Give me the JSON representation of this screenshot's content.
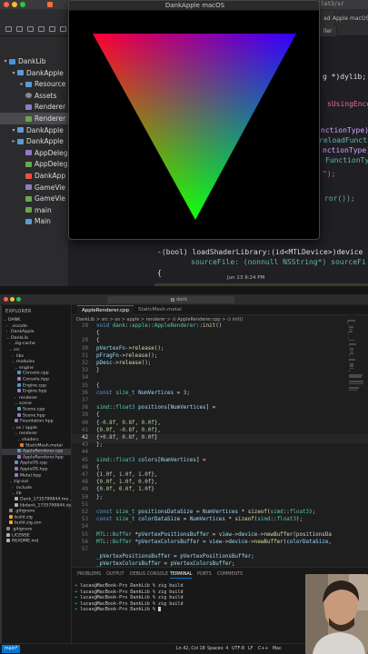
{
  "xcode": {
    "window_title": "DankApple macOS",
    "title_fragment": "ullet3/sr",
    "tabs": [
      "ad",
      "ller",
      "Apple macOS"
    ],
    "status_fragment": "Jun 13 9:24 PM",
    "navigator": [
      {
        "label": "DankLib",
        "depth": 0,
        "open": true,
        "icon": "package-icon"
      },
      {
        "label": "DankApple",
        "depth": 1,
        "open": true,
        "icon": "folder-icon"
      },
      {
        "label": "Resource",
        "depth": 2,
        "open": false,
        "icon": "folder-icon"
      },
      {
        "label": "Assets",
        "depth": 2,
        "open": null,
        "icon": "assets-icon"
      },
      {
        "label": "Renderer",
        "depth": 2,
        "open": null,
        "icon": "header-icon"
      },
      {
        "label": "Renderer",
        "depth": 2,
        "open": null,
        "icon": "objc-icon",
        "selected": true
      },
      {
        "label": "DankApple",
        "depth": 1,
        "open": true,
        "icon": "folder-icon"
      },
      {
        "label": "DankApple",
        "depth": 1,
        "open": false,
        "icon": "folder-icon"
      },
      {
        "label": "AppDeleg",
        "depth": 2,
        "open": null,
        "icon": "header-icon"
      },
      {
        "label": "AppDeleg",
        "depth": 2,
        "open": null,
        "icon": "objc-icon"
      },
      {
        "label": "DankApp",
        "depth": 2,
        "open": null,
        "icon": "swift-icon"
      },
      {
        "label": "GameVie",
        "depth": 2,
        "open": null,
        "icon": "header-icon"
      },
      {
        "label": "GameVie",
        "depth": 2,
        "open": null,
        "icon": "objc-icon"
      },
      {
        "label": "main",
        "depth": 2,
        "open": null,
        "icon": "objc-icon"
      },
      {
        "label": "Main",
        "depth": 2,
        "open": null,
        "icon": "storyboard-icon"
      }
    ],
    "code_fragments": [
      "g *)dylib; -",
      "sUsingEncoding",
      "nctionType)d",
      "reloadFunctio",
      "nctionType)dls",
      "FunctionType)",
      "\");",
      "ror());",
      "-(bool) loadShaderLibrary:(id<MTLDevice>)device",
      "sourceFile: (nonnull NSString*) sourceFi",
      "{"
    ]
  },
  "vscode": {
    "search_text": "dank",
    "explorer_title": "EXPLORER",
    "tree": [
      {
        "label": "DANK",
        "depth": 0,
        "kind": "root"
      },
      {
        "label": ".vscode",
        "depth": 1,
        "kind": "folder",
        "collapsed": true
      },
      {
        "label": "DankApple",
        "depth": 1,
        "kind": "folder",
        "collapsed": true
      },
      {
        "label": "DankLib",
        "depth": 1,
        "kind": "folder"
      },
      {
        "label": ".zig-cache",
        "depth": 2,
        "kind": "folder",
        "collapsed": true
      },
      {
        "label": "src",
        "depth": 2,
        "kind": "folder"
      },
      {
        "label": "libs",
        "depth": 3,
        "kind": "folder",
        "collapsed": true
      },
      {
        "label": "modules",
        "depth": 3,
        "kind": "folder"
      },
      {
        "label": "engine",
        "depth": 4,
        "kind": "folder"
      },
      {
        "label": "Console.cpp",
        "depth": 5,
        "kind": "cpp"
      },
      {
        "label": "Console.hpp",
        "depth": 5,
        "kind": "hpp"
      },
      {
        "label": "Engine.cpp",
        "depth": 5,
        "kind": "cpp"
      },
      {
        "label": "Engine.hpp",
        "depth": 5,
        "kind": "hpp"
      },
      {
        "label": "renderer",
        "depth": 4,
        "kind": "folder",
        "collapsed": true
      },
      {
        "label": "scene",
        "depth": 4,
        "kind": "folder"
      },
      {
        "label": "Scene.cpp",
        "depth": 5,
        "kind": "cpp"
      },
      {
        "label": "Scene.hpp",
        "depth": 5,
        "kind": "hpp"
      },
      {
        "label": "Foundation.hpp",
        "depth": 4,
        "kind": "hpp"
      },
      {
        "label": "os / apple",
        "depth": 3,
        "kind": "folder"
      },
      {
        "label": "renderer",
        "depth": 4,
        "kind": "folder"
      },
      {
        "label": "shaders",
        "depth": 5,
        "kind": "folder"
      },
      {
        "label": "StaticMesh.metal",
        "depth": 6,
        "kind": "metal"
      },
      {
        "label": "AppleRenderer.cpp",
        "depth": 5,
        "kind": "cpp",
        "selected": true
      },
      {
        "label": "AppleRenderer.hpp",
        "depth": 5,
        "kind": "hpp"
      },
      {
        "label": "AppleOS.cpp",
        "depth": 4,
        "kind": "cpp"
      },
      {
        "label": "AppleOS.hpp",
        "depth": 4,
        "kind": "hpp"
      },
      {
        "label": "Metal.hpp",
        "depth": 4,
        "kind": "hpp"
      },
      {
        "label": "zig-out",
        "depth": 2,
        "kind": "folder"
      },
      {
        "label": "include",
        "depth": 3,
        "kind": "folder",
        "collapsed": true
      },
      {
        "label": "lib",
        "depth": 3,
        "kind": "folder"
      },
      {
        "label": "Dank_1735799844.mo...",
        "depth": 4,
        "kind": "file"
      },
      {
        "label": "libdank_1735799844.dy...",
        "depth": 4,
        "kind": "file"
      },
      {
        "label": ".gitignore",
        "depth": 2,
        "kind": "git"
      },
      {
        "label": "build.zig",
        "depth": 2,
        "kind": "zig"
      },
      {
        "label": "build.zig.zon",
        "depth": 2,
        "kind": "zig"
      },
      {
        "label": ".gitignore",
        "depth": 1,
        "kind": "git"
      },
      {
        "label": "LICENSE",
        "depth": 1,
        "kind": "info"
      },
      {
        "label": "README.md",
        "depth": 1,
        "kind": "info"
      }
    ],
    "tabs": [
      {
        "label": "AppleRenderer.cpp",
        "active": true
      },
      {
        "label": "StaticMesh.metal",
        "active": false
      }
    ],
    "breadcrumb": "DankLib > src > os > apple > renderer > ⊙ AppleRenderer.cpp > ⊙ init()",
    "current_line": 42,
    "code": [
      {
        "n": "28",
        "t": "void dank::apple::AppleRenderer::init()"
      },
      {
        "n": "",
        "t": "{"
      },
      {
        "n": "29",
        "t": "    {"
      },
      {
        "n": "30",
        "t": "        pVertexFn->release();"
      },
      {
        "n": "31",
        "t": "        pFragFn->release();"
      },
      {
        "n": "32",
        "t": "        pDesc->release();"
      },
      {
        "n": "33",
        "t": "    }"
      },
      {
        "n": "34",
        "t": ""
      },
      {
        "n": "35",
        "t": "    {"
      },
      {
        "n": "36",
        "t": "        const size_t NumVertices = 3;"
      },
      {
        "n": "37",
        "t": ""
      },
      {
        "n": "38",
        "t": "        simd::float3 positions[NumVertices] ="
      },
      {
        "n": "39",
        "t": "        {"
      },
      {
        "n": "40",
        "t": "            {-0.8f, 0.8f, 0.0f},"
      },
      {
        "n": "41",
        "t": "            {0.0f, -0.8f, 0.0f},"
      },
      {
        "n": "42",
        "t": "            {+0.8f, 0.8f, 0.0f}"
      },
      {
        "n": "43",
        "t": "        };"
      },
      {
        "n": "44",
        "t": ""
      },
      {
        "n": "45",
        "t": "        simd::float3 colors[NumVertices] ="
      },
      {
        "n": "46",
        "t": "        {"
      },
      {
        "n": "47",
        "t": "            {1.0f, 1.0f, 1.0f},"
      },
      {
        "n": "48",
        "t": "            {0.0f, 1.0f, 0.0f},"
      },
      {
        "n": "49",
        "t": "            {0.0f, 0.0f, 1.0f}"
      },
      {
        "n": "50",
        "t": "        };"
      },
      {
        "n": "51",
        "t": ""
      },
      {
        "n": "52",
        "t": "        const size_t positionsDataSize = NumVertices * sizeof(simd::float3);"
      },
      {
        "n": "53",
        "t": "        const size_t colorDataSize = NumVertices * sizeof(simd::float3);"
      },
      {
        "n": "54",
        "t": ""
      },
      {
        "n": "55",
        "t": "        MTL::Buffer *pVertexPositionsBuffer = view->device->newBuffer(positionsDa"
      },
      {
        "n": "56",
        "t": "        MTL::Buffer *pVertexColorsBuffer = view->device->newBuffer(colorDataSize,"
      },
      {
        "n": "57",
        "t": ""
      },
      {
        "n": "",
        "t": "        _pVertexPositionsBuffer = pVertexPositionsBuffer;"
      },
      {
        "n": "",
        "t": "        _pVertexColorsBuffer = pVertexColorsBuffer;"
      }
    ],
    "panel_tabs": [
      "PROBLEMS",
      "OUTPUT",
      "DEBUG CONSOLE",
      "TERMINAL",
      "PORTS",
      "COMMENTS"
    ],
    "terminal_lines": [
      "lucas@MacBook-Pro DankLib % zig build",
      "lucas@MacBook-Pro DankLib % zig build",
      "lucas@MacBook-Pro DankLib % zig build",
      "lucas@MacBook-Pro DankLib % zig build",
      "lucas@MacBook-Pro DankLib % "
    ],
    "status": {
      "branch": "main*",
      "position": "Ln 42, Col 18",
      "spaces": "Spaces: 4",
      "encoding": "UTF-8",
      "eol": "LF",
      "language": "C++",
      "platform": "Mac"
    }
  },
  "colors": {
    "triangle_top_left": "#ff0000",
    "triangle_top_right": "#0000ff",
    "triangle_bottom": "#00ff00",
    "accent": "#0078d4"
  }
}
